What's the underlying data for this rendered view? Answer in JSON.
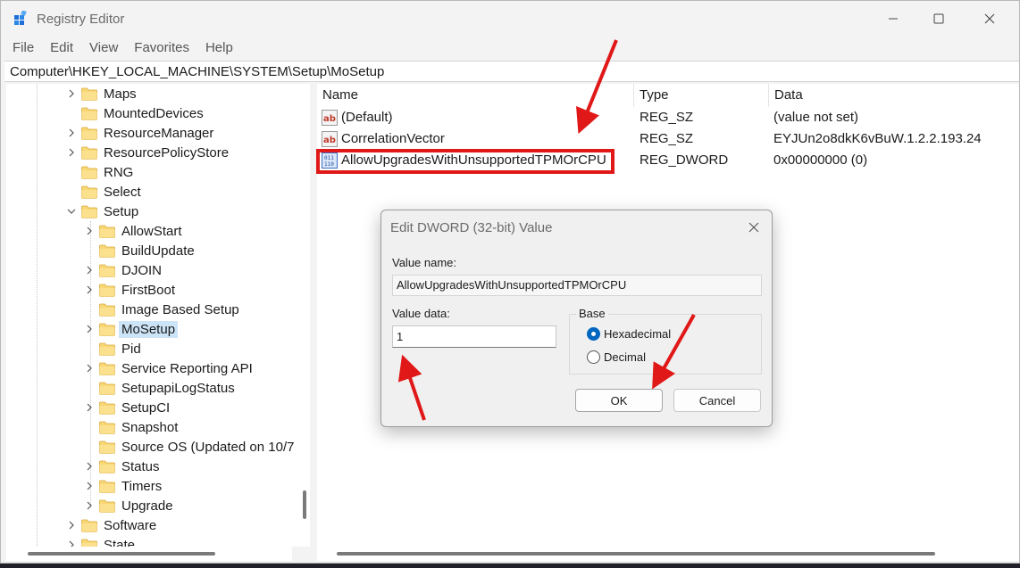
{
  "window": {
    "title": "Registry Editor"
  },
  "menu": [
    "File",
    "Edit",
    "View",
    "Favorites",
    "Help"
  ],
  "address": "Computer\\HKEY_LOCAL_MACHINE\\SYSTEM\\Setup\\MoSetup",
  "tree": [
    {
      "label": "Maps",
      "level": 1,
      "expander": true
    },
    {
      "label": "MountedDevices",
      "level": 1,
      "expander": false
    },
    {
      "label": "ResourceManager",
      "level": 1,
      "expander": true
    },
    {
      "label": "ResourcePolicyStore",
      "level": 1,
      "expander": true
    },
    {
      "label": "RNG",
      "level": 1,
      "expander": false
    },
    {
      "label": "Select",
      "level": 1,
      "expander": false
    },
    {
      "label": "Setup",
      "level": 1,
      "expander": true,
      "expanded": true
    },
    {
      "label": "AllowStart",
      "level": 2,
      "expander": true
    },
    {
      "label": "BuildUpdate",
      "level": 2,
      "expander": false
    },
    {
      "label": "DJOIN",
      "level": 2,
      "expander": true
    },
    {
      "label": "FirstBoot",
      "level": 2,
      "expander": true
    },
    {
      "label": "Image Based Setup",
      "level": 2,
      "expander": false
    },
    {
      "label": "MoSetup",
      "level": 2,
      "expander": true,
      "selected": true
    },
    {
      "label": "Pid",
      "level": 2,
      "expander": false
    },
    {
      "label": "Service Reporting API",
      "level": 2,
      "expander": true
    },
    {
      "label": "SetupapiLogStatus",
      "level": 2,
      "expander": false
    },
    {
      "label": "SetupCI",
      "level": 2,
      "expander": true
    },
    {
      "label": "Snapshot",
      "level": 2,
      "expander": false
    },
    {
      "label": "Source OS (Updated on 10/7",
      "level": 2,
      "expander": false
    },
    {
      "label": "Status",
      "level": 2,
      "expander": true
    },
    {
      "label": "Timers",
      "level": 2,
      "expander": true
    },
    {
      "label": "Upgrade",
      "level": 2,
      "expander": true
    },
    {
      "label": "Software",
      "level": 1,
      "expander": true
    },
    {
      "label": "State",
      "level": 1,
      "expander": true
    }
  ],
  "values": {
    "columns": {
      "name": "Name",
      "type": "Type",
      "data": "Data"
    },
    "rows": [
      {
        "icon": "string-value-icon",
        "name": "(Default)",
        "type": "REG_SZ",
        "data": "(value not set)"
      },
      {
        "icon": "string-value-icon",
        "name": "CorrelationVector",
        "type": "REG_SZ",
        "data": "EYJUn2o8dkK6vBuW.1.2.2.193.24"
      },
      {
        "icon": "dword-value-icon",
        "name": "AllowUpgradesWithUnsupportedTPMOrCPU",
        "type": "REG_DWORD",
        "data": "0x00000000 (0)"
      }
    ]
  },
  "dialog": {
    "title": "Edit DWORD (32-bit) Value",
    "value_name_label": "Value name:",
    "value_name": "AllowUpgradesWithUnsupportedTPMOrCPU",
    "value_data_label": "Value data:",
    "value_data": "1",
    "base_label": "Base",
    "base_options": [
      {
        "label": "Hexadecimal",
        "checked": true
      },
      {
        "label": "Decimal",
        "checked": false
      }
    ],
    "ok_label": "OK",
    "cancel_label": "Cancel"
  },
  "colors": {
    "annotation": "#e01818",
    "selection": "#cce4f7",
    "accent": "#0067c0",
    "folder": "#f8d775"
  }
}
